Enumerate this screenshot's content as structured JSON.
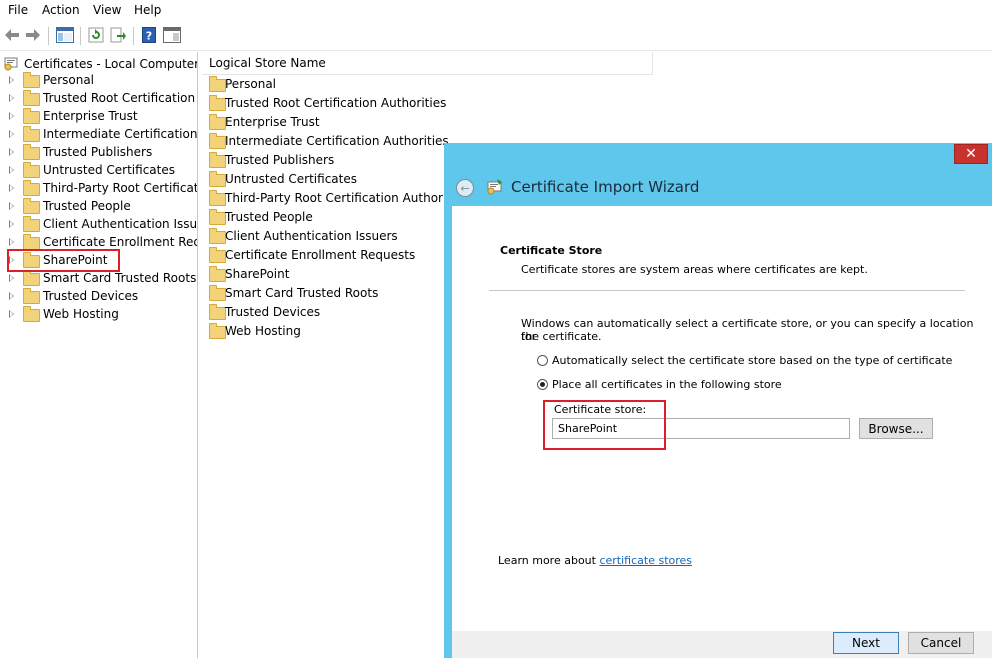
{
  "menu": [
    "File",
    "Action",
    "View",
    "Help"
  ],
  "tree": {
    "root": "Certificates - Local Computer",
    "items": [
      "Personal",
      "Trusted Root Certification Au",
      "Enterprise Trust",
      "Intermediate Certification Au",
      "Trusted Publishers",
      "Untrusted Certificates",
      "Third-Party Root Certificatior",
      "Trusted People",
      "Client Authentication Issuers",
      "Certificate Enrollment Reques",
      "SharePoint",
      "Smart Card Trusted Roots",
      "Trusted Devices",
      "Web Hosting"
    ]
  },
  "list": {
    "column_header": "Logical Store Name",
    "rows": [
      "Personal",
      "Trusted Root Certification Authorities",
      "Enterprise Trust",
      "Intermediate Certification Authorities",
      "Trusted Publishers",
      "Untrusted Certificates",
      "Third-Party Root Certification Authorities",
      "Trusted People",
      "Client Authentication Issuers",
      "Certificate Enrollment Requests",
      "SharePoint",
      "Smart Card Trusted Roots",
      "Trusted Devices",
      "Web Hosting"
    ]
  },
  "wizard": {
    "title": "Certificate Import Wizard",
    "close_glyph": "✕",
    "section_title": "Certificate Store",
    "section_desc": "Certificate stores are system areas where certificates are kept.",
    "intro_line1": "Windows can automatically select a certificate store, or you can specify a location for",
    "intro_line2": "the certificate.",
    "option_auto": "Automatically select the certificate store based on the type of certificate",
    "option_place": "Place all certificates in the following store",
    "selected_option": "place",
    "store_label": "Certificate store:",
    "store_value": "SharePoint",
    "browse_label": "Browse...",
    "learn_prefix": "Learn more about ",
    "learn_link": "certificate stores",
    "next_label": "Next",
    "cancel_label": "Cancel"
  },
  "colors": {
    "wizard_frame": "#5fc6ec",
    "highlight": "#d9202b",
    "close_button": "#c7332c",
    "link": "#1565c0"
  }
}
